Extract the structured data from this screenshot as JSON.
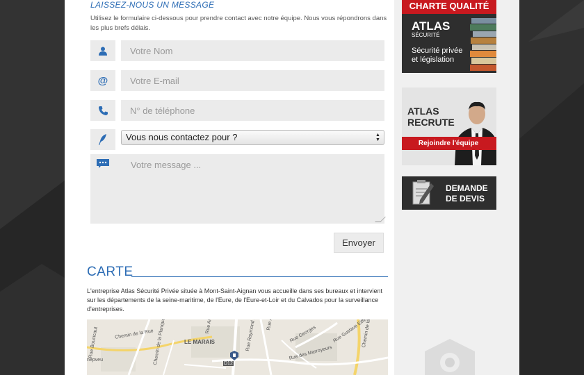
{
  "contact_form": {
    "title": "LAISSEZ-NOUS UN MESSAGE",
    "intro": "Utilisez le formulaire ci-dessous pour prendre contact avec notre équipe. Nous vous répondrons dans les plus brefs délais.",
    "name_placeholder": "Votre Nom",
    "email_placeholder": "Votre E-mail",
    "phone_placeholder": "N° de téléphone",
    "reason_selected": "Vous nous contactez pour ?",
    "message_placeholder": "Votre message ...",
    "submit_label": "Envoyer"
  },
  "map_section": {
    "title": "CARTE",
    "text": "L'entreprise Atlas Sécurité Privée située à Mont-Saint-Aignan vous accueille dans ses bureaux et intervient sur les départements de la seine-maritime, de l'Eure, de l'Eure-et-Loir et du Calvados pour la surveillance d'entreprises.",
    "labels": [
      "Chemin de la Rue",
      "LE MARAIS",
      "Rue André Sokhan",
      "Rue Alfred Kl",
      "Rue Georges",
      "Rue Raymond Aron",
      "Rue des Marroyeurs",
      "Rue Gustave Eiffel",
      "Chemin de la Forêt Verte",
      "Rue Boucicaut",
      "Chemin de la Planquette",
      "D12",
      "nepveu"
    ]
  },
  "sidebar": {
    "charte": {
      "header": "CHARTE QUALITÉ",
      "brand": "ATLAS",
      "brand_sub": "SÉCURITÉ",
      "line1": "Sécurité privée",
      "line2": "et législation"
    },
    "recrute": {
      "line1": "ATLAS",
      "line2": "RECRUTE",
      "button": "Rejoindre l'équipe"
    },
    "devis": {
      "line1": "DEMANDE",
      "line2": "DE DEVIS"
    }
  },
  "icons": {
    "name": "person-icon",
    "email": "at-sign-icon",
    "phone": "phone-icon",
    "reason": "feather-icon",
    "message": "speech-bubble-icon"
  },
  "colors": {
    "accent": "#2d6db5",
    "brand_red": "#c8191f",
    "background": "#2a2a2a",
    "field": "#ebebeb"
  }
}
